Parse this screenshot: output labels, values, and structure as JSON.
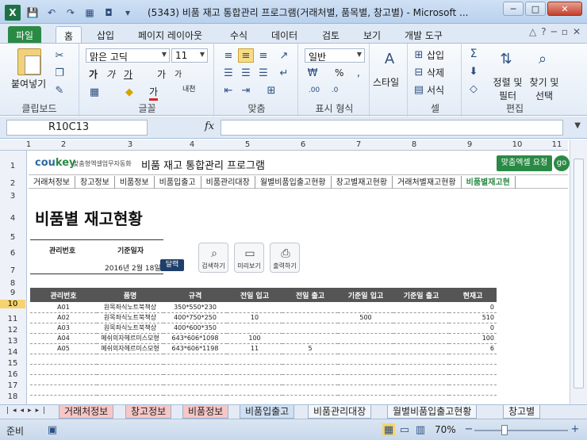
{
  "window": {
    "title": "(5343) 비품 재고 통합관리 프로그램(거래처별, 품목별, 창고별) - Microsoft ...",
    "minimize": "─",
    "maximize": "□",
    "close": "✕"
  },
  "ribbon_tabs": [
    "파일",
    "홈",
    "삽입",
    "페이지 레이아웃",
    "수식",
    "데이터",
    "검토",
    "보기",
    "개발 도구"
  ],
  "ribbon": {
    "clipboard": {
      "paste": "붙여넣기",
      "label": "클립보드"
    },
    "font": {
      "name": "맑은 고딕",
      "size": "11",
      "label": "글꼴",
      "bold": "가",
      "italic": "가",
      "underline": "가",
      "grow": "가",
      "shrink": "가",
      "phonetic": "내천"
    },
    "alignment": {
      "label": "맞춤"
    },
    "number": {
      "format": "일반",
      "label": "표시 형식",
      "percent": "%"
    },
    "styles": {
      "label": "스타일"
    },
    "cells": {
      "insert": "삽입",
      "delete": "삭제",
      "format": "서식",
      "label": "셀"
    },
    "editing": {
      "sort": "정렬 및 필터",
      "find": "찾기 및 선택",
      "label": "편집"
    }
  },
  "formula_bar": {
    "name_box": "R10C13",
    "fx": "fx",
    "formula": ""
  },
  "columns": [
    "1",
    "2",
    "3",
    "4",
    "5",
    "6",
    "7",
    "8",
    "9",
    "10",
    "11"
  ],
  "rows": [
    "1",
    "2",
    "3",
    "4",
    "5",
    "6",
    "7",
    "8",
    "9",
    "10",
    "11",
    "12",
    "13",
    "14",
    "15",
    "16",
    "17",
    "18",
    "19"
  ],
  "selected_row": "10",
  "header": {
    "logo_co": "cou",
    "logo_key": "key",
    "logo_sub": "맞춤형엑셀업무자동화",
    "program_title": "비품 재고 통합관리 프로그램",
    "order_button": "맞춤엑셀 요청",
    "go_button": "go"
  },
  "nav_items": [
    "거래처정보",
    "창고정보",
    "비품정보",
    "비품입출고",
    "비품관리대장",
    "월별비품입출고현황",
    "창고별재고현황",
    "거래처별재고현황",
    "비품별재고현"
  ],
  "nav_active_index": 8,
  "page_title": "비품별 재고현황",
  "info": {
    "mgmt_no_label": "관리번호",
    "base_date_label": "기준일자",
    "date_value": "2016년 2월 18일",
    "calendar_button": "달력"
  },
  "tools": {
    "search": "검색하기",
    "preview": "미리보기",
    "print": "출력하기"
  },
  "table": {
    "headers": [
      "관리번호",
      "품명",
      "규격",
      "전일 입고",
      "전일 출고",
      "기준일 입고",
      "기준일 출고",
      "현재고"
    ],
    "rows": [
      [
        "A01",
        "원목좌식노트북책상",
        "350*550*230",
        "",
        "",
        "",
        "",
        "0"
      ],
      [
        "A02",
        "원목좌식노트북책상",
        "400*750*250",
        "10",
        "",
        "500",
        "",
        "510"
      ],
      [
        "A03",
        "원목좌식노트북책상",
        "400*600*350",
        "",
        "",
        "",
        "",
        "0"
      ],
      [
        "A04",
        "메쉬의자헤르미스모형",
        "643*606*1098",
        "100",
        "",
        "",
        "",
        "100"
      ],
      [
        "A05",
        "메쉬의자헤르미스모형",
        "643*606*1198",
        "11",
        "5",
        "",
        "",
        "6"
      ]
    ]
  },
  "sheet_tabs": [
    "거래처정보",
    "창고정보",
    "비품정보",
    "비품입출고",
    "비품관리대장",
    "월별비품입출고현황",
    "창고별"
  ],
  "status": {
    "ready": "준비",
    "zoom": "70%",
    "zoom_out": "−",
    "zoom_in": "+"
  }
}
